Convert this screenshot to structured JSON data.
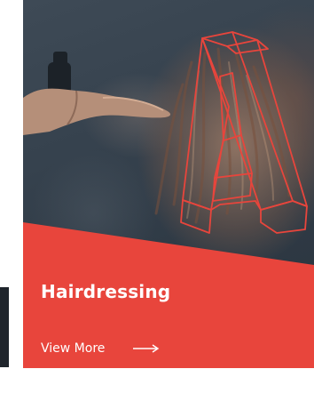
{
  "card": {
    "title": "Hairdressing",
    "link_label": "View More",
    "link_icon": "arrow-right-icon"
  },
  "colors": {
    "accent": "#e8453c",
    "text": "#ffffff",
    "photo_base": "#2f3b46"
  }
}
